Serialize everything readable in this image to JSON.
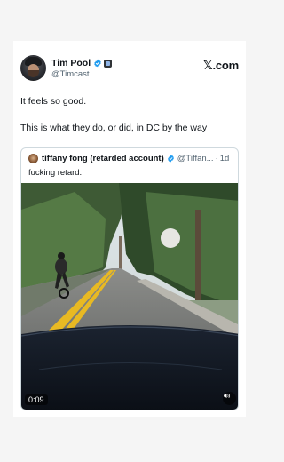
{
  "post": {
    "author_name": "Tim Pool",
    "author_handle": "@Timcast",
    "brand": "𝕏.com",
    "text_line1": "It feels so good.",
    "text_line2": "This is what they do, or did, in DC by the way"
  },
  "quoted": {
    "author_name": "tiffany fong (retarded account)",
    "author_handle": "@Tiffan...",
    "separator": "·",
    "time": "1d",
    "text": "fucking retard."
  },
  "video": {
    "duration": "0:09",
    "mute_icon": "speaker-icon"
  },
  "colors": {
    "verified_blue": "#1d9bf0",
    "page_bg": "#f5f5f5",
    "card_bg": "#ffffff",
    "road_line": "#e8b923"
  }
}
